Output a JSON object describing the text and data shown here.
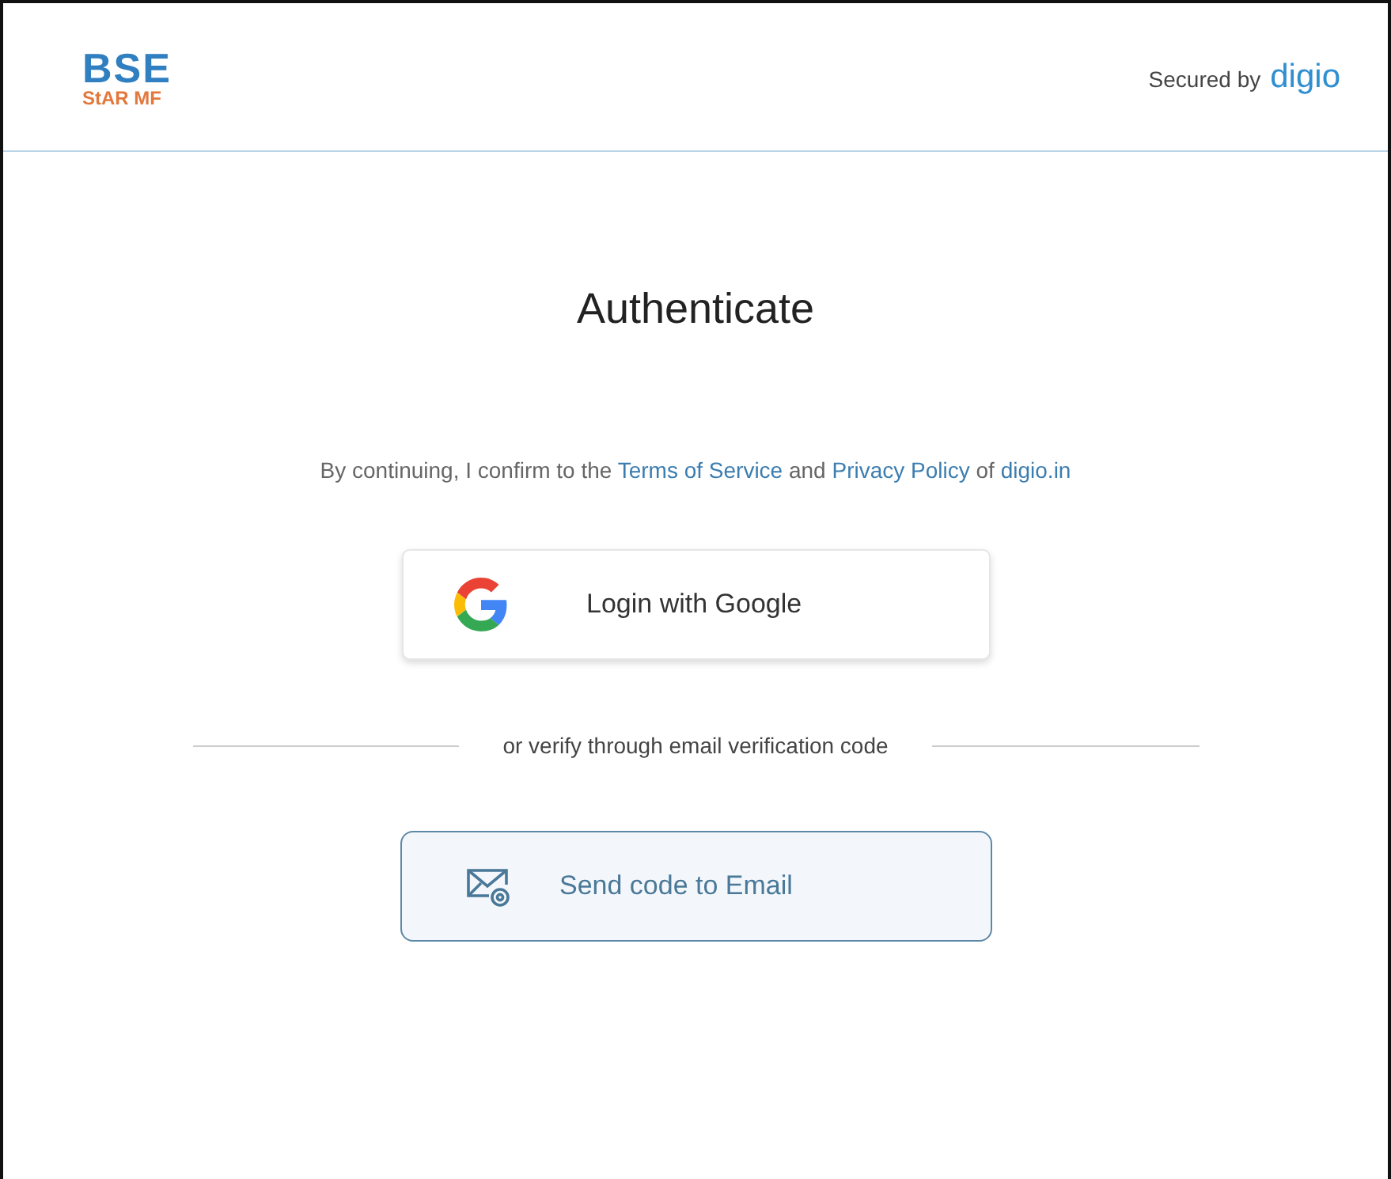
{
  "header": {
    "logo": {
      "line_1": "BSE",
      "line_2": "StAR MF"
    },
    "secured_by": "Secured by",
    "brand": "digio"
  },
  "title": "Authenticate",
  "consent": [
    {
      "kind": "text",
      "text": "By continuing, I confirm to the "
    },
    {
      "kind": "link",
      "text": "Terms of Service"
    },
    {
      "kind": "text",
      "text": " and "
    },
    {
      "kind": "link",
      "text": "Privacy Policy"
    },
    {
      "kind": "text",
      "text": " of "
    },
    {
      "kind": "link",
      "text": "digio.in"
    }
  ],
  "google_button": "Login with Google",
  "divider_text": "or verify through email verification code",
  "email_button": "Send code to Email"
}
